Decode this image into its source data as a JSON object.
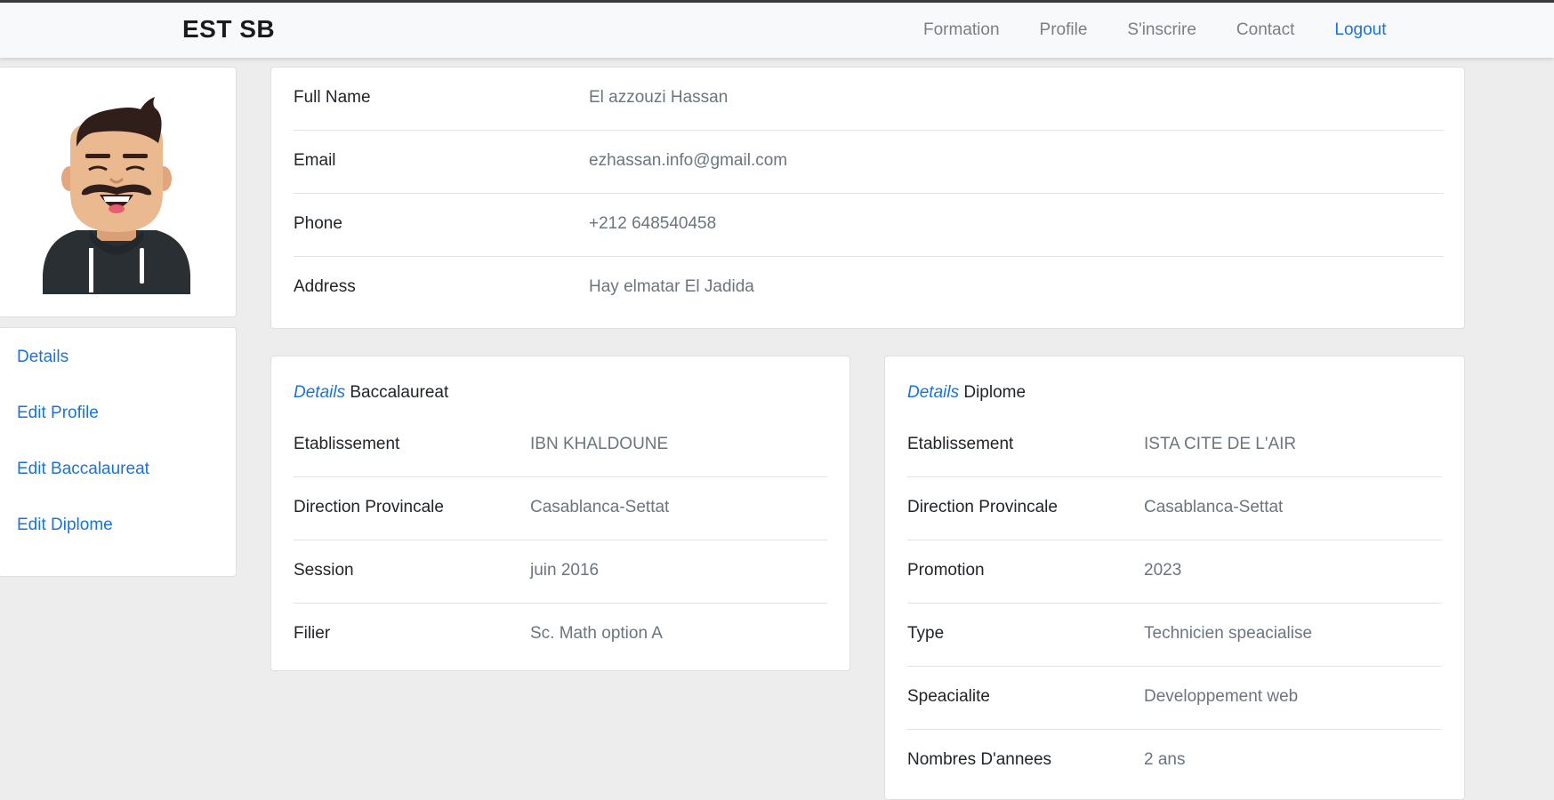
{
  "app": {
    "brand": "EST SB"
  },
  "nav": {
    "items": [
      {
        "label": "Formation",
        "active": false
      },
      {
        "label": "Profile",
        "active": false
      },
      {
        "label": "S'inscrire",
        "active": false
      },
      {
        "label": "Contact",
        "active": false
      },
      {
        "label": "Logout",
        "active": true
      }
    ]
  },
  "sidebar": {
    "avatar_icon": "cartoon-man-avatar",
    "menu": [
      "Details",
      "Edit Profile",
      "Edit Baccalaureat",
      "Edit Diplome"
    ]
  },
  "profile": {
    "rows": [
      {
        "label": "Full Name",
        "value": "El azzouzi Hassan"
      },
      {
        "label": "Email",
        "value": "ezhassan.info@gmail.com"
      },
      {
        "label": "Phone",
        "value": "+212 648540458"
      },
      {
        "label": "Address",
        "value": "Hay elmatar El Jadida"
      }
    ]
  },
  "baccalaureat": {
    "title_prefix": "Details",
    "title": "Baccalaureat",
    "rows": [
      {
        "label": "Etablissement",
        "value": "IBN KHALDOUNE"
      },
      {
        "label": "Direction Provincale",
        "value": "Casablanca-Settat"
      },
      {
        "label": "Session",
        "value": "juin 2016"
      },
      {
        "label": "Filier",
        "value": "Sc. Math option A"
      }
    ]
  },
  "diplome": {
    "title_prefix": "Details",
    "title": "Diplome",
    "rows": [
      {
        "label": "Etablissement",
        "value": "ISTA CITE DE L'AIR"
      },
      {
        "label": "Direction Provincale",
        "value": "Casablanca-Settat"
      },
      {
        "label": "Promotion",
        "value": "2023"
      },
      {
        "label": "Type",
        "value": "Technicien speacialise"
      },
      {
        "label": "Speacialite",
        "value": "Developpement web"
      },
      {
        "label": "Nombres D'annees",
        "value": "2 ans"
      }
    ]
  },
  "colors": {
    "link": "#1a73d9",
    "muted": "#6c757d",
    "background": "#ededed"
  }
}
